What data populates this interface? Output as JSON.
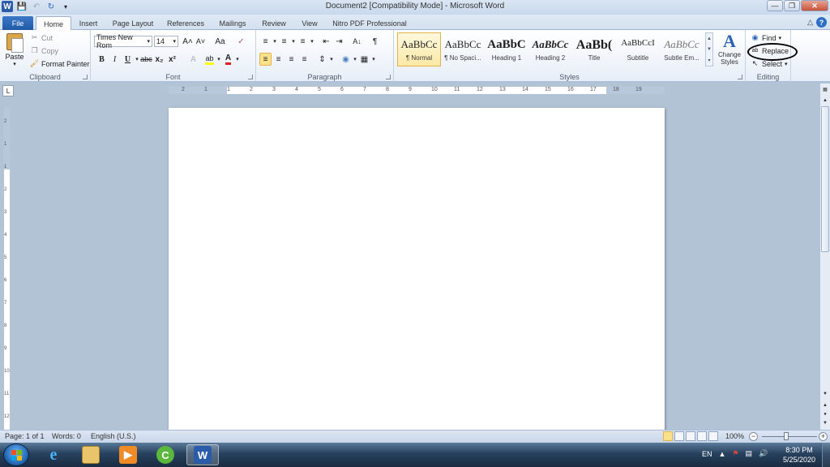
{
  "window": {
    "title": "Document2 [Compatibility Mode] - Microsoft Word",
    "app_icon": "W",
    "controls": [
      "minimize",
      "restore",
      "close"
    ]
  },
  "tabs": {
    "file": "File",
    "items": [
      "Home",
      "Insert",
      "Page Layout",
      "References",
      "Mailings",
      "Review",
      "View",
      "Nitro PDF Professional"
    ],
    "active": "Home"
  },
  "clipboard": {
    "paste": "Paste",
    "cut": "Cut",
    "copy": "Copy",
    "format_painter": "Format Painter",
    "label": "Clipboard"
  },
  "font": {
    "name": "Times New Rom",
    "size": "14",
    "grow": "A˄",
    "shrink": "A˅",
    "case": "Aa",
    "bold": "B",
    "italic": "I",
    "underline": "U",
    "strike": "abc",
    "subscript": "x₂",
    "superscript": "x²",
    "label": "Font"
  },
  "paragraph": {
    "label": "Paragraph",
    "pilcrow": "¶",
    "sort": "A↓"
  },
  "styles": {
    "label": "Styles",
    "items": [
      {
        "sample": "AaBbCc",
        "name": "¶ Normal"
      },
      {
        "sample": "AaBbCc",
        "name": "¶ No Spaci..."
      },
      {
        "sample": "AaBbC",
        "name": "Heading 1"
      },
      {
        "sample": "AaBbCc",
        "name": "Heading 2"
      },
      {
        "sample": "AaBb(",
        "name": "Title"
      },
      {
        "sample": "AaBbCcI",
        "name": "Subtitle"
      },
      {
        "sample": "AaBbCc",
        "name": "Subtle Em..."
      }
    ],
    "change_styles": "Change Styles",
    "change_styles_glyph": "A"
  },
  "editing": {
    "label": "Editing",
    "find": "Find",
    "replace": "Replace",
    "select": "Select"
  },
  "ruler": {
    "h_numbers": [
      "2",
      "1",
      "1",
      "2",
      "3",
      "4",
      "5",
      "6",
      "7",
      "8",
      "9",
      "10",
      "11",
      "12",
      "13",
      "14",
      "15",
      "16",
      "17",
      "18",
      "19"
    ],
    "v_numbers": [
      "2",
      "1",
      "1",
      "2",
      "3",
      "4",
      "5",
      "6",
      "7",
      "8",
      "9",
      "10",
      "11",
      "12"
    ]
  },
  "status": {
    "page": "Page: 1 of 1",
    "words": "Words: 0",
    "language": "English (U.S.)",
    "zoom": "100%",
    "zoom_level": 0.5
  },
  "taskbar": {
    "apps": [
      "internet-explorer",
      "file-explorer",
      "media-player",
      "camtasia",
      "microsoft-word"
    ],
    "active_app": "microsoft-word",
    "language": "EN",
    "time": "8:30 PM",
    "date": "5/25/2020"
  },
  "colors": {
    "accent": "#2a5caa",
    "selected_style": "#fde18a",
    "highlight": "#ffff00",
    "font_color": "#e02020"
  }
}
